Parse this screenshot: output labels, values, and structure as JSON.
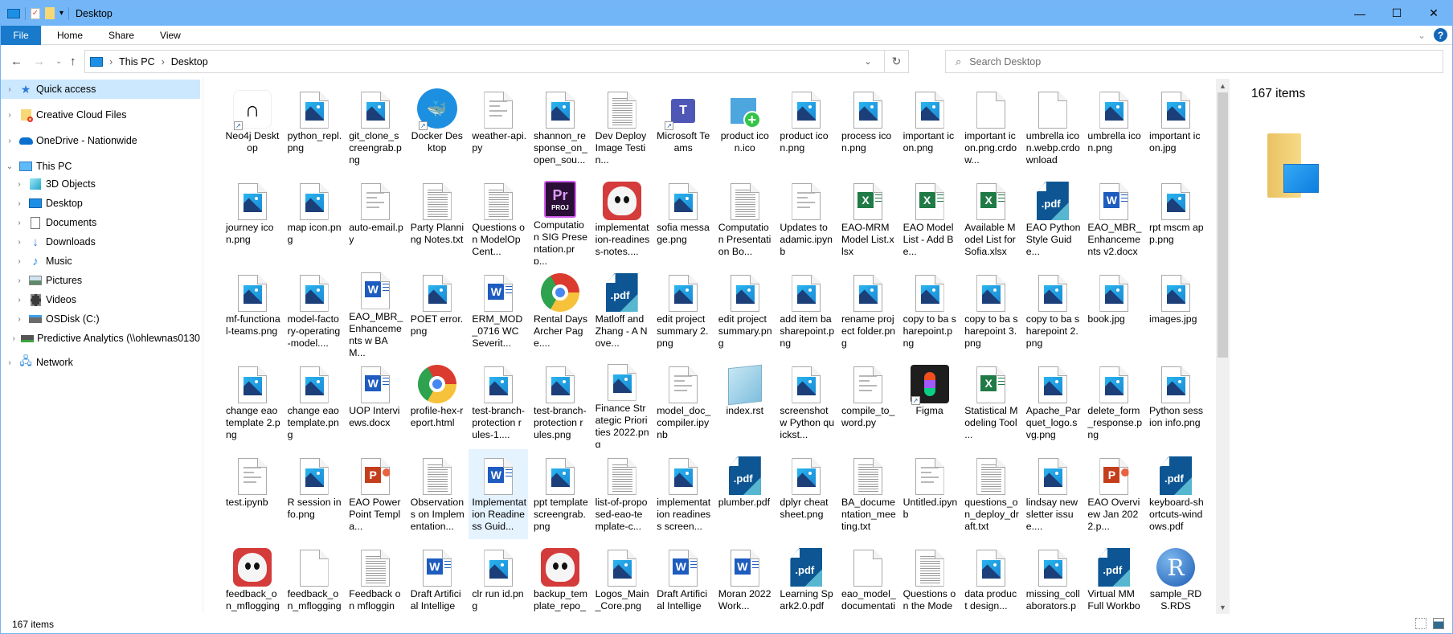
{
  "window": {
    "title": "Desktop",
    "quick_access_icons": [
      "this-pc-icon",
      "properties-check-icon",
      "new-folder-icon",
      "customize-dropdown-icon"
    ],
    "controls": {
      "minimize": "—",
      "maximize": "☐",
      "close": "✕"
    }
  },
  "ribbon": {
    "tabs": [
      {
        "label": "File",
        "active": true
      },
      {
        "label": "Home"
      },
      {
        "label": "Share"
      },
      {
        "label": "View"
      }
    ],
    "expand_glyph": "⌄",
    "help_glyph": "?"
  },
  "navbar": {
    "back": "←",
    "forward": "→",
    "recent": "⌄",
    "up": "↑",
    "breadcrumbs": [
      "This PC",
      "Desktop"
    ],
    "separator": "›",
    "dropdown_glyph": "⌄",
    "refresh_glyph": "↻",
    "search": {
      "placeholder": "Search Desktop",
      "value": ""
    }
  },
  "sidebar": {
    "items": [
      {
        "label": "Quick access",
        "icon": "quick-access-star-icon",
        "level": 0,
        "expanded": false,
        "selected": true
      },
      {
        "label": "Creative Cloud Files",
        "icon": "creative-cloud-folder-icon",
        "level": 0,
        "expanded": false
      },
      {
        "label": "OneDrive - Nationwide",
        "icon": "onedrive-cloud-icon",
        "level": 0,
        "expanded": false
      },
      {
        "label": "This PC",
        "icon": "this-pc-icon",
        "level": 0,
        "expanded": true
      },
      {
        "label": "3D Objects",
        "icon": "3d-objects-icon",
        "level": 1
      },
      {
        "label": "Desktop",
        "icon": "desktop-icon",
        "level": 1
      },
      {
        "label": "Documents",
        "icon": "documents-icon",
        "level": 1
      },
      {
        "label": "Downloads",
        "icon": "downloads-arrow-icon",
        "level": 1
      },
      {
        "label": "Music",
        "icon": "music-note-icon",
        "level": 1
      },
      {
        "label": "Pictures",
        "icon": "pictures-icon",
        "level": 1
      },
      {
        "label": "Videos",
        "icon": "videos-film-icon",
        "level": 1
      },
      {
        "label": "OSDisk (C:)",
        "icon": "os-disk-icon",
        "level": 1
      },
      {
        "label": "Predictive Analytics (\\\\ohlewnas0130",
        "icon": "network-drive-icon",
        "level": 1
      },
      {
        "label": "Network",
        "icon": "network-icon",
        "level": 0,
        "expanded": false
      }
    ]
  },
  "files": [
    {
      "name": "Neo4j Desktop",
      "type": "neo4j",
      "shortcut": true
    },
    {
      "name": "python_repl.png",
      "type": "image"
    },
    {
      "name": "git_clone_screengrab.png",
      "type": "image"
    },
    {
      "name": "Docker Desktop",
      "type": "docker",
      "shortcut": true
    },
    {
      "name": "weather-api.py",
      "type": "code"
    },
    {
      "name": "shannon_response_on_open_sou...",
      "type": "image"
    },
    {
      "name": "Dev Deploy Image Testin...",
      "type": "text"
    },
    {
      "name": "Microsoft Teams",
      "type": "teams",
      "shortcut": true
    },
    {
      "name": "product icon.ico",
      "type": "productico"
    },
    {
      "name": "product icon.png",
      "type": "image"
    },
    {
      "name": "process icon.png",
      "type": "image"
    },
    {
      "name": "important icon.png",
      "type": "image"
    },
    {
      "name": "important icon.png.crdow...",
      "type": "blank"
    },
    {
      "name": "umbrella icon.webp.crdownload",
      "type": "blank"
    },
    {
      "name": "umbrella icon.png",
      "type": "image"
    },
    {
      "name": "important icon.jpg",
      "type": "image"
    },
    {
      "name": "journey icon.png",
      "type": "image"
    },
    {
      "name": "map icon.png",
      "type": "image"
    },
    {
      "name": "auto-email.py",
      "type": "code"
    },
    {
      "name": "Party Planning Notes.txt",
      "type": "text"
    },
    {
      "name": "Questions on ModelOp Cent...",
      "type": "text"
    },
    {
      "name": "Computation SIG Presentation.prp...",
      "type": "prproj"
    },
    {
      "name": "implementation-readiness-notes....",
      "type": "ghost"
    },
    {
      "name": "sofia message.png",
      "type": "image"
    },
    {
      "name": "Computation Presentation Bo...",
      "type": "text"
    },
    {
      "name": "Updates to adamic.ipynb",
      "type": "code"
    },
    {
      "name": "EAO-MRM Model List.xlsx",
      "type": "excel"
    },
    {
      "name": "EAO Model List - Add Be...",
      "type": "excel"
    },
    {
      "name": "Available Model List for Sofia.xlsx",
      "type": "excel"
    },
    {
      "name": "EAO Python Style Guide...",
      "type": "pdf"
    },
    {
      "name": "EAO_MBR_Enhancements v2.docx",
      "type": "word"
    },
    {
      "name": "rpt mscm app.png",
      "type": "image"
    },
    {
      "name": "mf-functional-teams.png",
      "type": "image"
    },
    {
      "name": "model-factory-operating-model....",
      "type": "image"
    },
    {
      "name": "EAO_MBR_Enhancements w BAM...",
      "type": "word"
    },
    {
      "name": "POET error.png",
      "type": "image"
    },
    {
      "name": "ERM_MOD_0716 WC Severit...",
      "type": "word"
    },
    {
      "name": "Rental Days Archer Page....",
      "type": "chrome"
    },
    {
      "name": "Matloff and Zhang - A Nove...",
      "type": "pdf"
    },
    {
      "name": "edit project summary 2.png",
      "type": "image"
    },
    {
      "name": "edit project summary.png",
      "type": "image"
    },
    {
      "name": "add item ba sharepoint.png",
      "type": "image"
    },
    {
      "name": "rename project folder.png",
      "type": "image"
    },
    {
      "name": "copy to ba sharepoint.png",
      "type": "image"
    },
    {
      "name": "copy to ba sharepoint 3.png",
      "type": "image"
    },
    {
      "name": "copy to ba sharepoint 2.png",
      "type": "image"
    },
    {
      "name": "book.jpg",
      "type": "image"
    },
    {
      "name": "images.jpg",
      "type": "image"
    },
    {
      "name": "change eao template 2.png",
      "type": "image"
    },
    {
      "name": "change eao template.png",
      "type": "image"
    },
    {
      "name": "UOP Interviews.docx",
      "type": "word"
    },
    {
      "name": "profile-hex-report.html",
      "type": "chrome"
    },
    {
      "name": "test-branch-protection rules-1....",
      "type": "image"
    },
    {
      "name": "test-branch-protection rules.png",
      "type": "image"
    },
    {
      "name": "Finance Strategic Priorities 2022.png",
      "type": "image"
    },
    {
      "name": "model_doc_compiler.ipynb",
      "type": "code"
    },
    {
      "name": "index.rst",
      "type": "notepad"
    },
    {
      "name": "screenshot w Python quickst...",
      "type": "image"
    },
    {
      "name": "compile_to_word.py",
      "type": "code"
    },
    {
      "name": "Figma",
      "type": "figma",
      "shortcut": true
    },
    {
      "name": "Statistical Modeling Tool ...",
      "type": "excel"
    },
    {
      "name": "Apache_Parquet_logo.svg.png",
      "type": "image"
    },
    {
      "name": "delete_form_response.png",
      "type": "image"
    },
    {
      "name": "Python session info.png",
      "type": "image"
    },
    {
      "name": "test.ipynb",
      "type": "code"
    },
    {
      "name": "R session info.png",
      "type": "image"
    },
    {
      "name": "EAO PowerPoint Templa...",
      "type": "ppt"
    },
    {
      "name": "Observations on Implementation...",
      "type": "text"
    },
    {
      "name": "Implementation Readiness Guid...",
      "type": "word",
      "highlighted": true
    },
    {
      "name": "ppt template screengrab.png",
      "type": "image"
    },
    {
      "name": "list-of-proposed-eao-template-c...",
      "type": "text"
    },
    {
      "name": "implementation readiness screen...",
      "type": "image"
    },
    {
      "name": "plumber.pdf",
      "type": "pdf"
    },
    {
      "name": "dplyr cheat sheet.png",
      "type": "image"
    },
    {
      "name": "BA_documentation_meeting.txt",
      "type": "text"
    },
    {
      "name": "Untitled.ipynb",
      "type": "code"
    },
    {
      "name": "questions_on_deploy_draft.txt",
      "type": "text"
    },
    {
      "name": "lindsay newsletter issue....",
      "type": "image"
    },
    {
      "name": "EAO Overview Jan 2022.p...",
      "type": "ppt"
    },
    {
      "name": "keyboard-shortcuts-windows.pdf",
      "type": "pdf"
    },
    {
      "name": "feedback_on_mflogging_d...",
      "type": "ghost"
    },
    {
      "name": "feedback_on_mflogging_d...",
      "type": "blank"
    },
    {
      "name": "Feedback on mflogging...",
      "type": "text"
    },
    {
      "name": "Draft Artificial Intelligen...",
      "type": "word"
    },
    {
      "name": "clr run id.png",
      "type": "image"
    },
    {
      "name": "backup_template_repo_ma...",
      "type": "ghost"
    },
    {
      "name": "Logos_Main_Core.png",
      "type": "image"
    },
    {
      "name": "Draft Artificial Intelligen...",
      "type": "word"
    },
    {
      "name": "Moran 2022 Work...",
      "type": "word"
    },
    {
      "name": "Learning Spark2.0.pdf",
      "type": "pdf"
    },
    {
      "name": "eao_model_documentatio...",
      "type": "blank"
    },
    {
      "name": "Questions on the Model...",
      "type": "text"
    },
    {
      "name": "data product design...",
      "type": "image"
    },
    {
      "name": "missing_collaborators.png",
      "type": "image"
    },
    {
      "name": "Virtual MM Full Workboo...",
      "type": "pdf"
    },
    {
      "name": "sample_RDS.RDS",
      "type": "rlogo"
    }
  ],
  "scroll": {
    "position_fraction": 0.0,
    "visible_fraction": 0.5
  },
  "details_pane": {
    "count_label": "167 items",
    "icon": "desktop-folder-icon"
  },
  "statusbar": {
    "count_label": "167 items",
    "views": [
      "details-view-icon",
      "large-icons-view-icon"
    ],
    "active_view": "large-icons-view-icon"
  },
  "colors": {
    "titlebar": "#73b6f8",
    "file_tab": "#1979ca",
    "selection": "#cce8ff",
    "hover": "#e5f3ff"
  }
}
